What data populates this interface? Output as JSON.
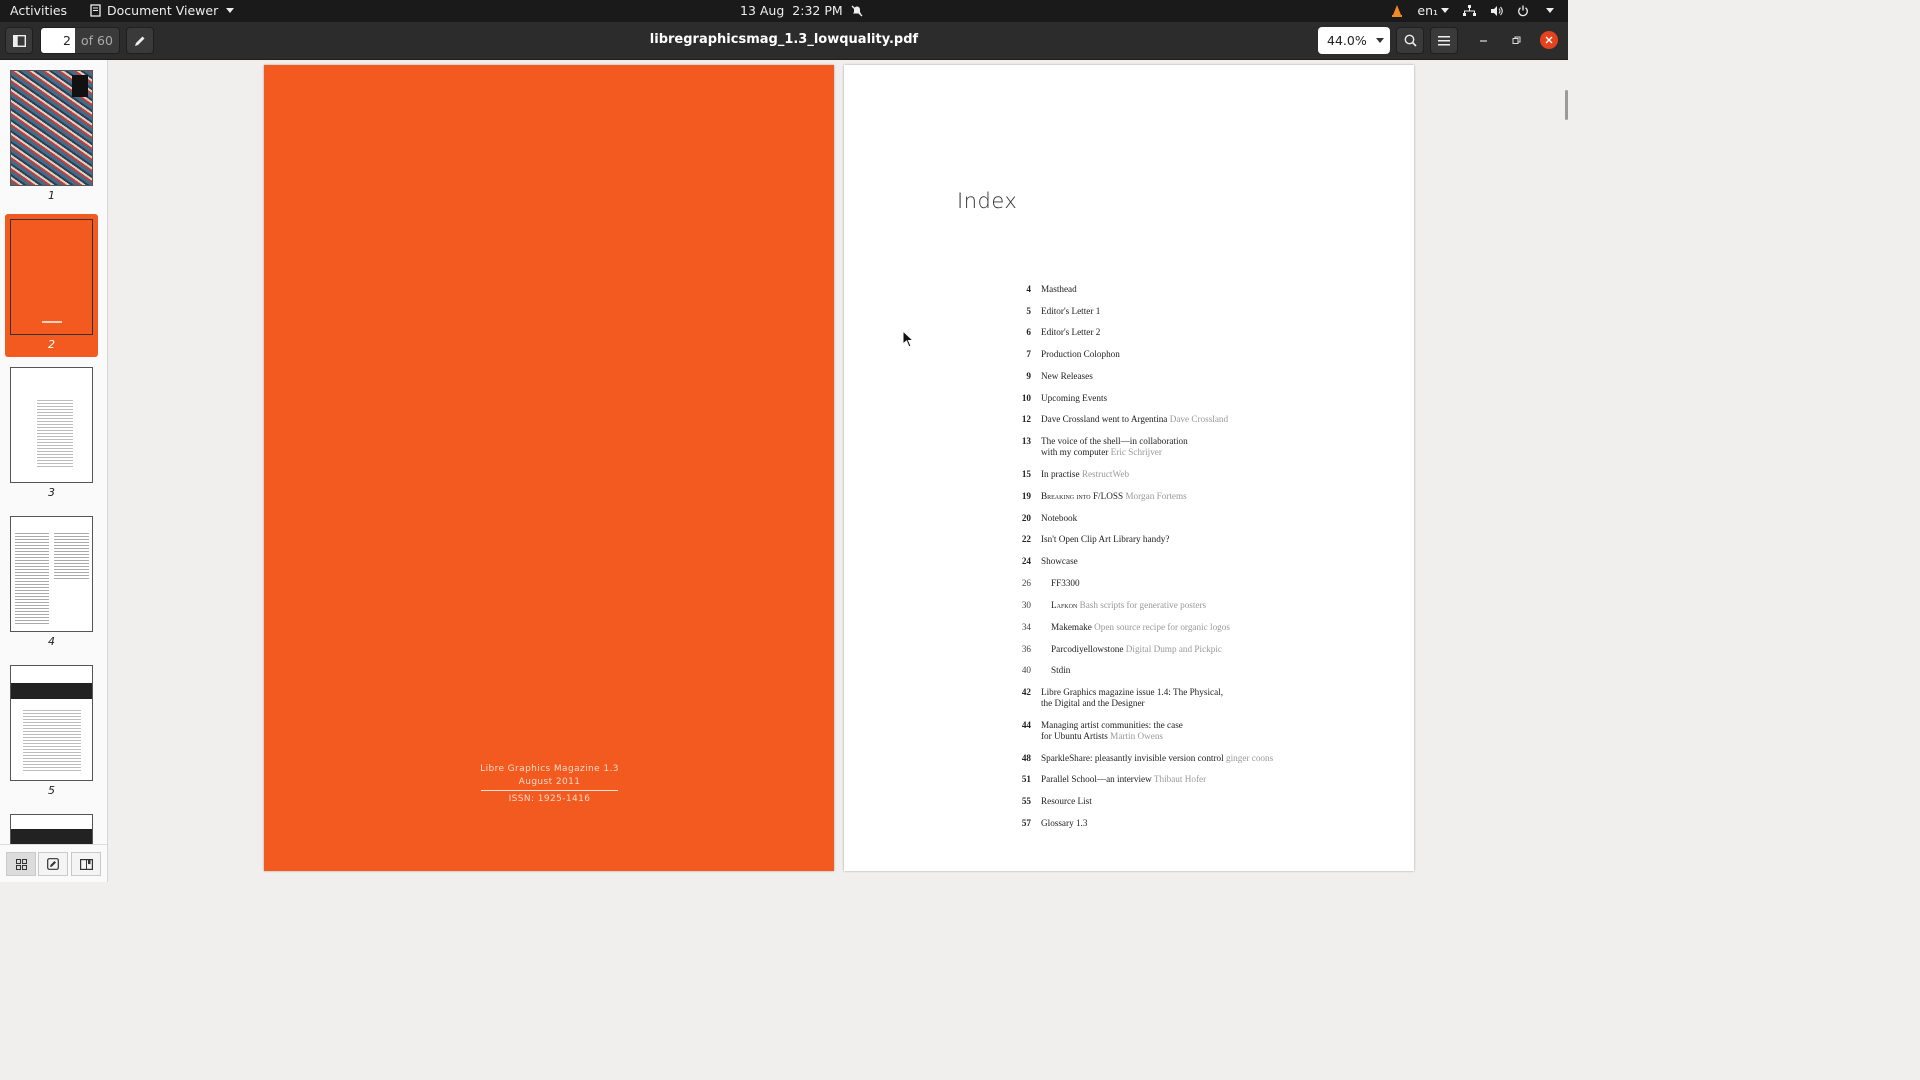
{
  "system": {
    "activities": "Activities",
    "app_name": "Document Viewer",
    "date": "13 Aug",
    "time": "2:32 PM",
    "lang": "en₁"
  },
  "header": {
    "current_page": "2",
    "page_total": "of 60",
    "filename": "libregraphicsmag_1.3_lowquality.pdf",
    "zoom": "44.0%"
  },
  "thumbnails": [
    {
      "label": "1"
    },
    {
      "label": "2",
      "selected": true
    },
    {
      "label": "3"
    },
    {
      "label": "4"
    },
    {
      "label": "5"
    }
  ],
  "colors": {
    "accent": "#f25a1f",
    "topbar": "#1a1a1a",
    "headerbar": "#2c2c2c"
  },
  "cover": {
    "line1": "Libre Graphics Magazine 1.3",
    "line2": "August 2011",
    "line3": "ISSN: 1925-1416"
  },
  "index": {
    "title": "Index",
    "entries": [
      {
        "num": "4",
        "title": "Masthead",
        "author": ""
      },
      {
        "num": "5",
        "title": "Editor's Letter 1",
        "author": ""
      },
      {
        "num": "6",
        "title": "Editor's Letter 2",
        "author": ""
      },
      {
        "num": "7",
        "title": "Production Colophon",
        "author": ""
      },
      {
        "num": "9",
        "title": "New Releases",
        "author": ""
      },
      {
        "num": "10",
        "title": "Upcoming Events",
        "author": ""
      },
      {
        "num": "12",
        "title": "Dave Crossland went to Argentina",
        "author": "Dave Crossland"
      },
      {
        "num": "13",
        "title": "The voice of the shell—in collaboration",
        "title2": "with my computer",
        "author": "Eric Schrijver"
      },
      {
        "num": "15",
        "title": "In practise",
        "author": "RestructWeb"
      },
      {
        "num": "19",
        "title": "Breaking into F/LOSS",
        "author": "Morgan Fortems"
      },
      {
        "num": "20",
        "title": "Notebook",
        "author": ""
      },
      {
        "num": "22",
        "title": "Isn't Open Clip Art Library handy?",
        "author": ""
      },
      {
        "num": "24",
        "title": "Showcase",
        "author": ""
      },
      {
        "num": "26",
        "title": "FF3300",
        "author": ""
      },
      {
        "num": "30",
        "title": "Lafkon",
        "author": "Bash scripts for generative posters"
      },
      {
        "num": "34",
        "title": "Makemake",
        "author": "Open source recipe for organic logos"
      },
      {
        "num": "36",
        "title": "Parcodiyellowstone",
        "author": "Digital Dump and Pickpic"
      },
      {
        "num": "40",
        "title": "Stdin",
        "author": ""
      },
      {
        "num": "42",
        "title": "Libre Graphics magazine issue 1.4: The Physical,",
        "title2": "the Digital and the Designer",
        "author": ""
      },
      {
        "num": "44",
        "title": "Managing artist communities: the case",
        "title2": "for Ubuntu Artists",
        "author": "Martin Owens"
      },
      {
        "num": "48",
        "title": "SparkleShare: pleasantly invisible version control",
        "author": "ginger coons"
      },
      {
        "num": "51",
        "title": "Parallel School—an interview",
        "author": "Thibaut Hofer"
      },
      {
        "num": "55",
        "title": "Resource List",
        "author": ""
      },
      {
        "num": "57",
        "title": "Glossary 1.3",
        "author": ""
      }
    ]
  }
}
